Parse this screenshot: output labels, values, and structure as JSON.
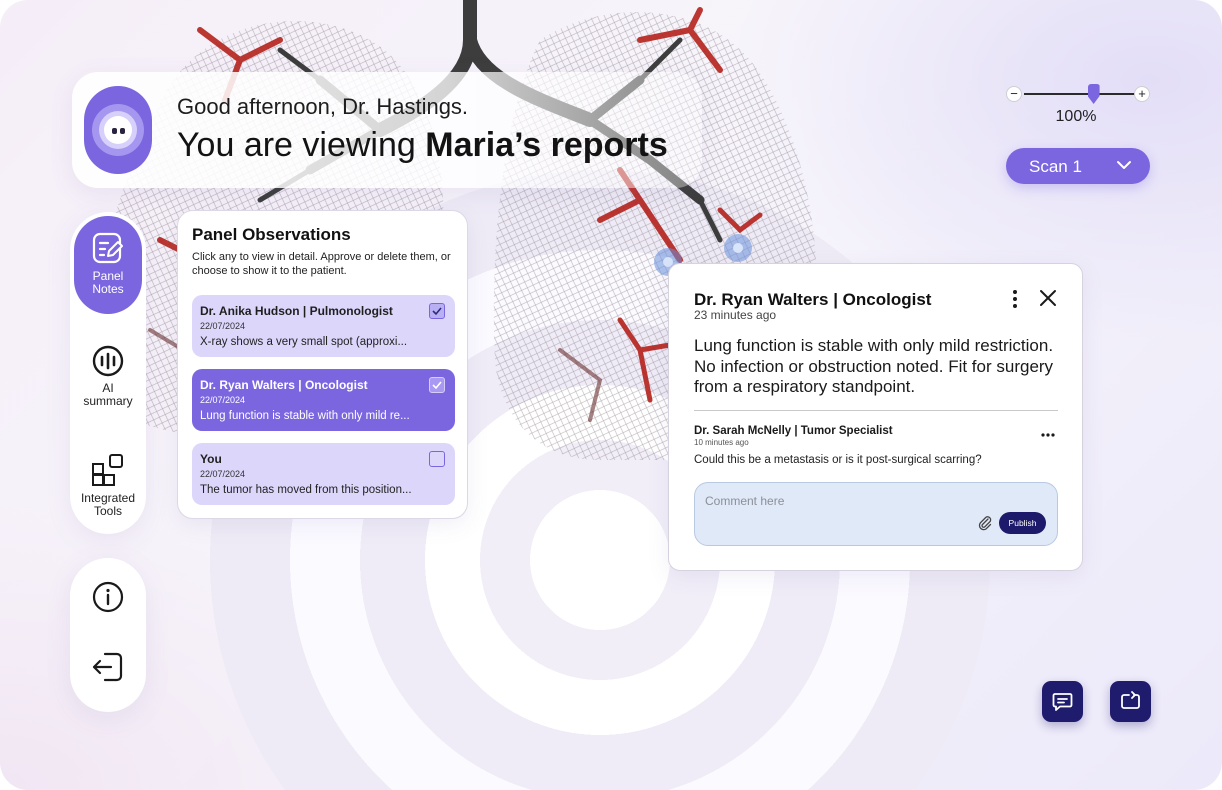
{
  "greeting": {
    "salutation": "Good afternoon, Dr. Hastings.",
    "viewing_prefix": "You are viewing ",
    "viewing_bold": "Maria’s reports"
  },
  "zoom": {
    "minus": "−",
    "plus": "+",
    "label": "100%",
    "level": 0.6
  },
  "scan": {
    "label": "Scan 1"
  },
  "rail": {
    "items": [
      {
        "label_line1": "Panel",
        "label_line2": "Notes",
        "icon": "notes-icon",
        "active": true
      },
      {
        "label_line1": "AI",
        "label_line2": "summary",
        "icon": "ai-summary-icon"
      },
      {
        "label_line1": "Integrated",
        "label_line2": "Tools",
        "icon": "integrated-tools-icon"
      }
    ],
    "bottom": [
      {
        "icon": "info-icon"
      },
      {
        "icon": "logout-icon"
      }
    ]
  },
  "panel": {
    "title": "Panel Observations",
    "subtitle": "Click any to view in detail. Approve or delete them, or choose to show it to the patient.",
    "observations": [
      {
        "author": "Dr. Anika Hudson | Pulmonologist",
        "date": "22/07/2024",
        "text": "X-ray shows a very small spot (approxi...",
        "checked": true,
        "active": false
      },
      {
        "author": "Dr. Ryan Walters | Oncologist",
        "date": "22/07/2024",
        "text": "Lung function is stable with only mild re...",
        "checked": true,
        "active": true
      },
      {
        "author": "You",
        "date": "22/07/2024",
        "text": "The tumor has moved from this position...",
        "checked": false,
        "active": false
      }
    ]
  },
  "detail": {
    "author": "Dr. Ryan Walters | Oncologist",
    "time": "23 minutes ago",
    "body": "Lung function is stable with only mild restriction. No infection or obstruction noted. Fit for surgery from a respiratory standpoint.",
    "comment": {
      "author": "Dr. Sarah McNelly | Tumor Specialist",
      "time": "10 minutes ago",
      "text": "Could this be a metastasis or is it post-surgical scarring?"
    },
    "input_placeholder": "Comment here",
    "publish_label": "Publish"
  },
  "colors": {
    "accent": "#7b66e0",
    "accent_light": "#dcd6fb",
    "navy": "#1f1b6d",
    "comment_bg": "#dfe9f8"
  }
}
